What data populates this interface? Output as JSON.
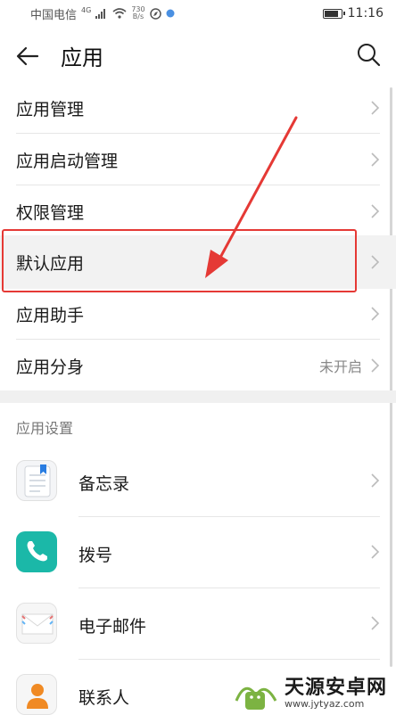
{
  "status_bar": {
    "carrier": "中国电信",
    "signal_label": "4G",
    "net_speed_value": "730",
    "net_speed_unit": "B/s",
    "time": "11:16",
    "battery_percent": 90
  },
  "header": {
    "title": "应用",
    "back_icon": "arrow-left-icon",
    "search_icon": "search-icon"
  },
  "menu": {
    "items": [
      {
        "label": "应用管理",
        "value": ""
      },
      {
        "label": "应用启动管理",
        "value": ""
      },
      {
        "label": "权限管理",
        "value": ""
      },
      {
        "label": "默认应用",
        "value": ""
      },
      {
        "label": "应用助手",
        "value": ""
      },
      {
        "label": "应用分身",
        "value": "未开启"
      }
    ]
  },
  "settings_section": {
    "title": "应用设置",
    "apps": [
      {
        "label": "备忘录",
        "icon": "notepad-icon"
      },
      {
        "label": "拨号",
        "icon": "phone-icon"
      },
      {
        "label": "电子邮件",
        "icon": "mail-icon"
      },
      {
        "label": "联系人",
        "icon": "contacts-icon"
      }
    ]
  },
  "watermark": {
    "text": "天源安卓网",
    "url": "www.jytyaz.com"
  },
  "colors": {
    "highlight_border": "#e53935",
    "phone_icon_bg": "#1bb8a8",
    "contacts_icon_bg": "#f08a24"
  }
}
